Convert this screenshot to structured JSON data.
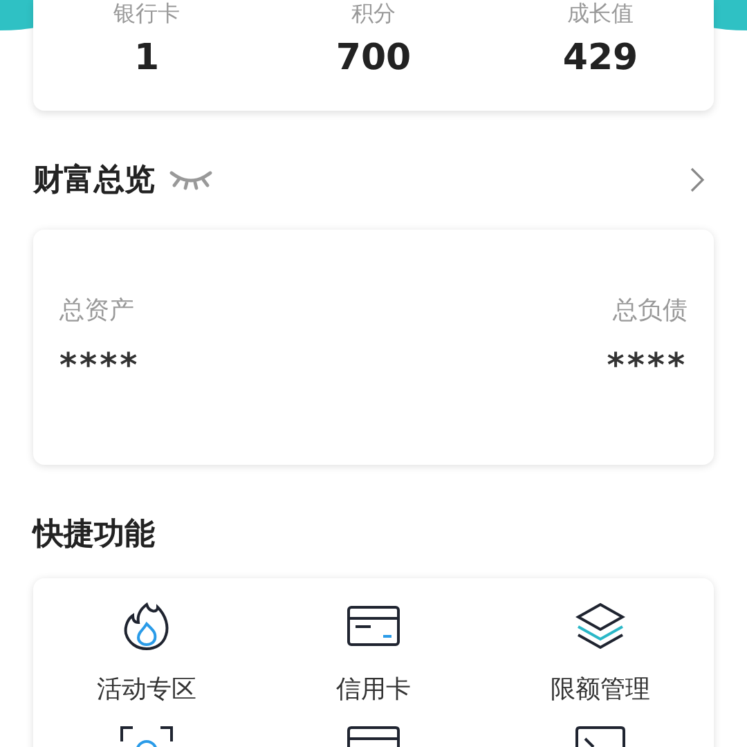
{
  "stats": [
    {
      "label": "银行卡",
      "value": "1"
    },
    {
      "label": "积分",
      "value": "700"
    },
    {
      "label": "成长值",
      "value": "429"
    }
  ],
  "wealth": {
    "title": "财富总览",
    "hidden": true,
    "assets": {
      "label": "总资产",
      "value": "****"
    },
    "liabilities": {
      "label": "总负债",
      "value": "****"
    }
  },
  "shortcuts": {
    "title": "快捷功能",
    "items": [
      {
        "kind": "fire",
        "label": "活动专区"
      },
      {
        "kind": "card",
        "label": "信用卡"
      },
      {
        "kind": "layers",
        "label": "限额管理"
      }
    ]
  }
}
